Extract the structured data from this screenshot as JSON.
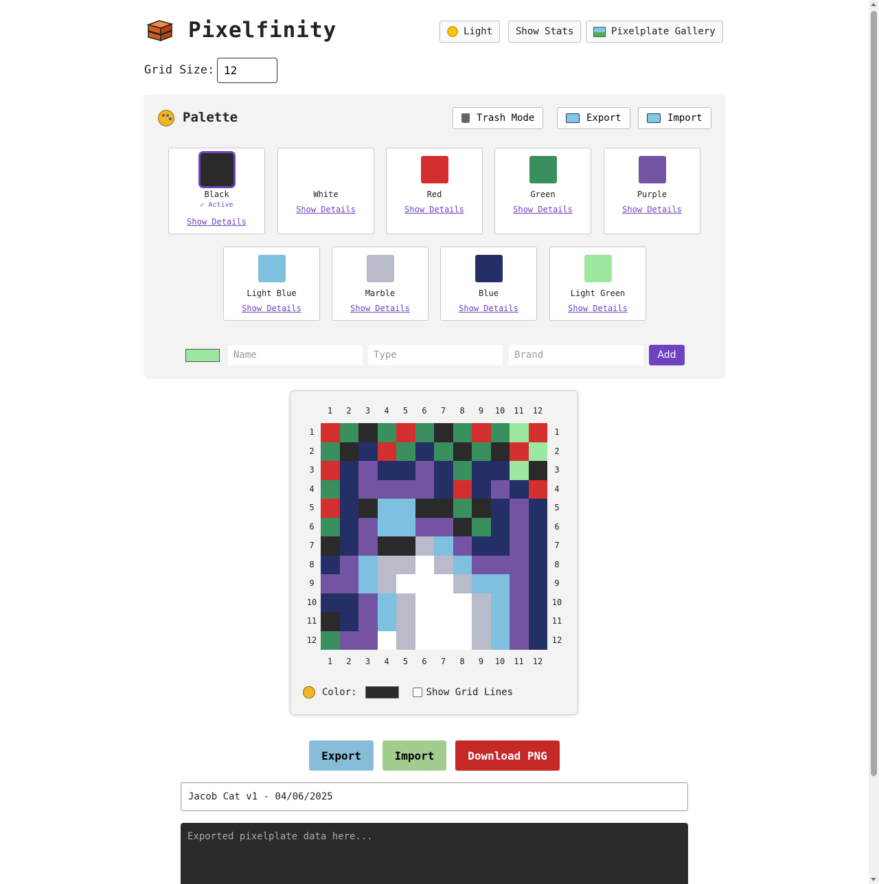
{
  "app": {
    "title": "Pixelfinity",
    "logo_icon": "brick-stack-icon"
  },
  "header": {
    "theme_label": "Light",
    "stats_label": "Show Stats",
    "gallery_label": "Pixelplate Gallery"
  },
  "grid_size": {
    "label": "Grid Size:",
    "value": "12"
  },
  "palette": {
    "title": "Palette",
    "trash_label": "Trash Mode",
    "export_label": "Export",
    "import_label": "Import",
    "active_label": "✓ Active",
    "details_label": "Show Details",
    "colors": [
      {
        "name": "Black",
        "hex": "#2a2a2a",
        "active": true
      },
      {
        "name": "White",
        "hex": "#ffffff"
      },
      {
        "name": "Red",
        "hex": "#d32f2f"
      },
      {
        "name": "Green",
        "hex": "#3a8f5e"
      },
      {
        "name": "Purple",
        "hex": "#7254a2"
      },
      {
        "name": "Light Blue",
        "hex": "#7ec0e0"
      },
      {
        "name": "Marble",
        "hex": "#babbca"
      },
      {
        "name": "Blue",
        "hex": "#242e67"
      },
      {
        "name": "Light Green",
        "hex": "#9de8a0"
      }
    ],
    "new_color": {
      "hex": "#9de8a0",
      "name_placeholder": "Name",
      "type_placeholder": "Type",
      "brand_placeholder": "Brand",
      "add_label": "Add"
    }
  },
  "canvas": {
    "columns": [
      "1",
      "2",
      "3",
      "4",
      "5",
      "6",
      "7",
      "8",
      "9",
      "10",
      "11",
      "12"
    ],
    "rows": [
      "1",
      "2",
      "3",
      "4",
      "5",
      "6",
      "7",
      "8",
      "9",
      "10",
      "11",
      "12"
    ],
    "color_map": {
      "R": "#d32f2f",
      "G": "#3a8f5e",
      "K": "#2a2a2a",
      "B": "#242e67",
      "P": "#7254a2",
      "L": "#7ec0e0",
      "M": "#babbca",
      "W": "#ffffff",
      "A": "#9de8a0"
    },
    "pixels": [
      [
        "R",
        "G",
        "K",
        "G",
        "R",
        "G",
        "K",
        "G",
        "R",
        "G",
        "A",
        "R"
      ],
      [
        "G",
        "K",
        "B",
        "R",
        "G",
        "B",
        "G",
        "K",
        "G",
        "K",
        "R",
        "A"
      ],
      [
        "R",
        "B",
        "P",
        "B",
        "B",
        "P",
        "B",
        "G",
        "B",
        "B",
        "A",
        "K"
      ],
      [
        "G",
        "B",
        "P",
        "P",
        "P",
        "P",
        "B",
        "R",
        "B",
        "P",
        "B",
        "R"
      ],
      [
        "R",
        "B",
        "K",
        "L",
        "L",
        "K",
        "K",
        "G",
        "K",
        "B",
        "P",
        "B"
      ],
      [
        "G",
        "B",
        "P",
        "L",
        "L",
        "P",
        "P",
        "K",
        "G",
        "B",
        "P",
        "B"
      ],
      [
        "K",
        "B",
        "P",
        "K",
        "K",
        "M",
        "L",
        "P",
        "B",
        "B",
        "P",
        "B"
      ],
      [
        "B",
        "P",
        "L",
        "M",
        "M",
        "W",
        "M",
        "L",
        "P",
        "P",
        "P",
        "B"
      ],
      [
        "P",
        "P",
        "L",
        "M",
        "W",
        "W",
        "W",
        "M",
        "L",
        "L",
        "P",
        "B"
      ],
      [
        "B",
        "B",
        "P",
        "L",
        "M",
        "W",
        "W",
        "W",
        "M",
        "L",
        "P",
        "B"
      ],
      [
        "K",
        "B",
        "P",
        "L",
        "M",
        "W",
        "W",
        "W",
        "M",
        "L",
        "P",
        "B"
      ],
      [
        "G",
        "P",
        "P",
        "W",
        "M",
        "W",
        "W",
        "W",
        "M",
        "L",
        "P",
        "B"
      ]
    ],
    "color_label": "Color:",
    "current_color": "#2a2a2a",
    "grid_lines_label": "Show Grid Lines",
    "grid_lines_checked": false
  },
  "actions": {
    "export_label": "Export",
    "import_label": "Import",
    "download_label": "Download PNG",
    "export_color": "#87bdd8",
    "import_color": "#a3cc8f",
    "download_color": "#c62828"
  },
  "plate_name": "Jacob Cat v1 - 04/06/2025",
  "export_placeholder": "Exported pixelplate data here..."
}
